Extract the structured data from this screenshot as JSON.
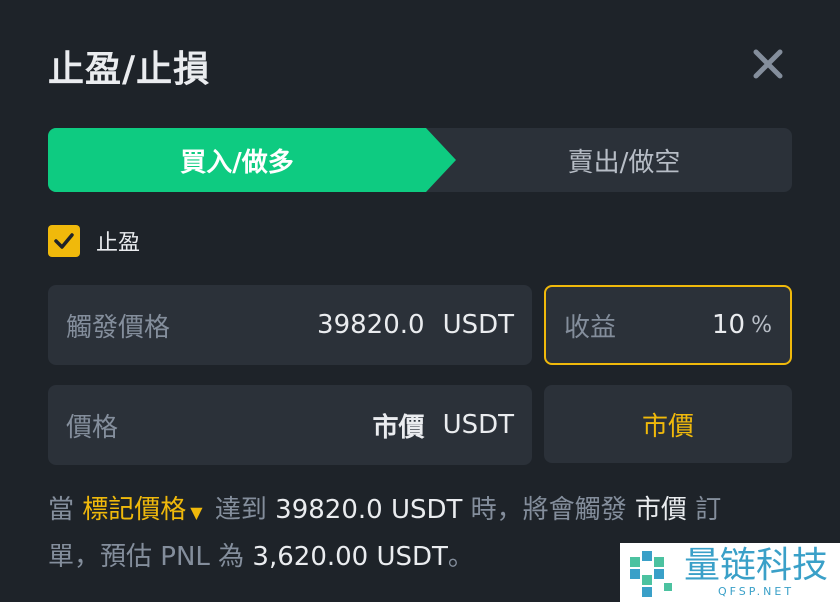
{
  "dialog": {
    "title": "止盈/止損"
  },
  "tabs": {
    "buy_label": "買入/做多",
    "sell_label": "賣出/做空",
    "active": "buy"
  },
  "take_profit": {
    "checked": true,
    "label": "止盈"
  },
  "trigger_price": {
    "label": "觸發價格",
    "value": "39820.0",
    "unit": "USDT"
  },
  "profit": {
    "label": "收益",
    "value": "10",
    "unit": "%"
  },
  "price": {
    "label": "價格",
    "value": "市價",
    "unit": "USDT"
  },
  "market_button": {
    "label": "市價"
  },
  "info": {
    "prefix": "當",
    "mark_price": "標記價格",
    "reach": "達到",
    "reach_value": "39820.0 USDT",
    "mid": "時，將會觸發",
    "order_type": "市價",
    "order": "訂單，預估 PNL 為",
    "pnl": "3,620.00 USDT",
    "suffix": "。"
  },
  "watermark": {
    "cn": "量链科技",
    "en": "QFSP.NET"
  },
  "colors": {
    "background": "#1e2329",
    "buy_green": "#0ecb81",
    "accent_yellow": "#f0b90b",
    "field_bg": "#2b3139"
  }
}
